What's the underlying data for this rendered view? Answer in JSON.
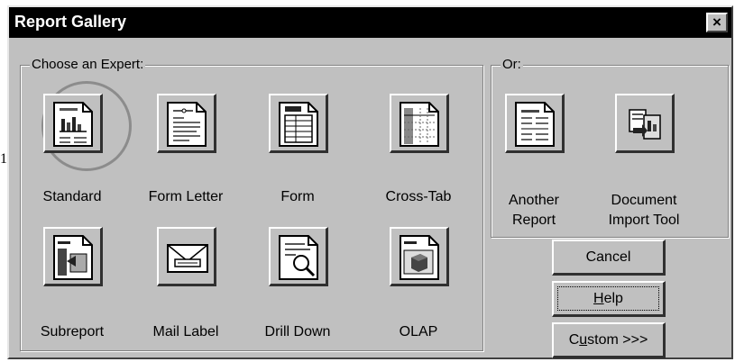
{
  "window": {
    "title": "Report Gallery",
    "close_label": "×"
  },
  "stray_mark": "1",
  "experts_group": {
    "legend": "Choose an Expert:",
    "items": [
      {
        "label": "Standard",
        "icon": "chart-document-icon"
      },
      {
        "label": "Form Letter",
        "icon": "letter-document-icon"
      },
      {
        "label": "Form",
        "icon": "form-document-icon"
      },
      {
        "label": "Cross-Tab",
        "icon": "crosstab-document-icon"
      },
      {
        "label": "Subreport",
        "icon": "subreport-document-icon"
      },
      {
        "label": "Mail Label",
        "icon": "envelope-icon"
      },
      {
        "label": "Drill Down",
        "icon": "magnifier-document-icon"
      },
      {
        "label": "OLAP",
        "icon": "cube-document-icon"
      }
    ]
  },
  "or_group": {
    "legend": "Or:",
    "items": [
      {
        "label_line1": "Another",
        "label_line2": "Report",
        "icon": "report-document-icon"
      },
      {
        "label_line1": "Document",
        "label_line2": "Import Tool",
        "icon": "import-document-icon"
      }
    ]
  },
  "buttons": {
    "cancel": "Cancel",
    "help_mnemonic": "H",
    "help_rest": "elp",
    "custom_pre": "C",
    "custom_mnemonic": "u",
    "custom_rest": "stom >>>"
  },
  "colors": {
    "dialog_bg": "#c0c0c0",
    "titlebar": "#000000",
    "title_text": "#ffffff"
  }
}
